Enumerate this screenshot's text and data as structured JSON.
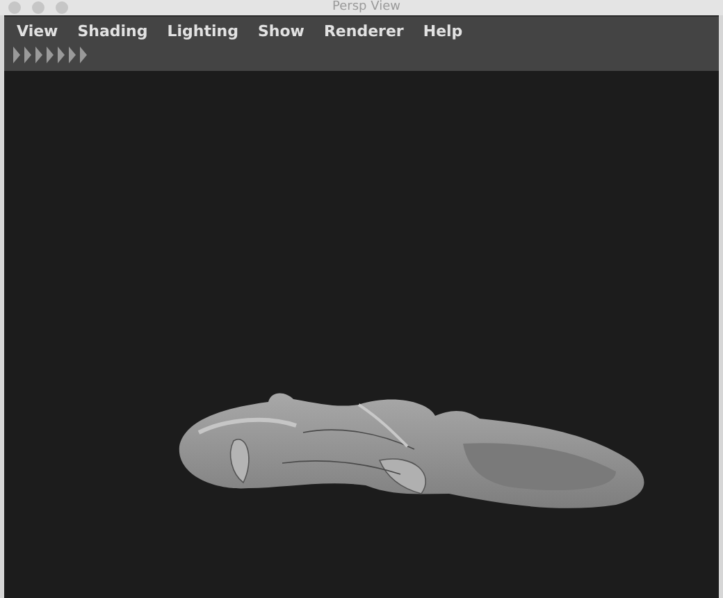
{
  "window": {
    "title": "Persp View"
  },
  "menu": [
    "View",
    "Shading",
    "Lighting",
    "Show",
    "Renderer",
    "Help"
  ]
}
